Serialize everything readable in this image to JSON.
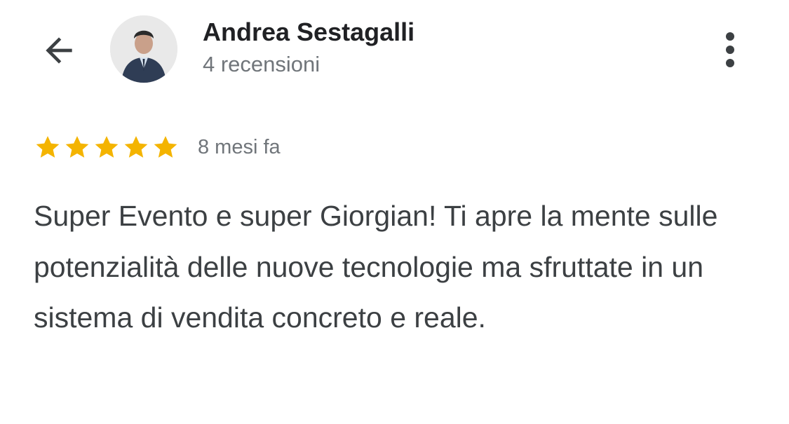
{
  "reviewer": {
    "name": "Andrea Sestagalli",
    "review_count": "4 recensioni"
  },
  "review": {
    "rating": 5,
    "rating_max": 5,
    "time": "8 mesi fa",
    "text": "Super Evento e super Giorgian! Ti apre la mente sulle potenzialità delle nuove tecnologie ma sfruttate in un sistema di vendita concreto e reale."
  },
  "icons": {
    "back": "arrow-back-icon",
    "more": "more-vert-icon",
    "star": "star-icon"
  },
  "colors": {
    "star": "#f4b400",
    "name": "#202124",
    "secondary": "#70757a",
    "body_text": "#3c4043"
  }
}
